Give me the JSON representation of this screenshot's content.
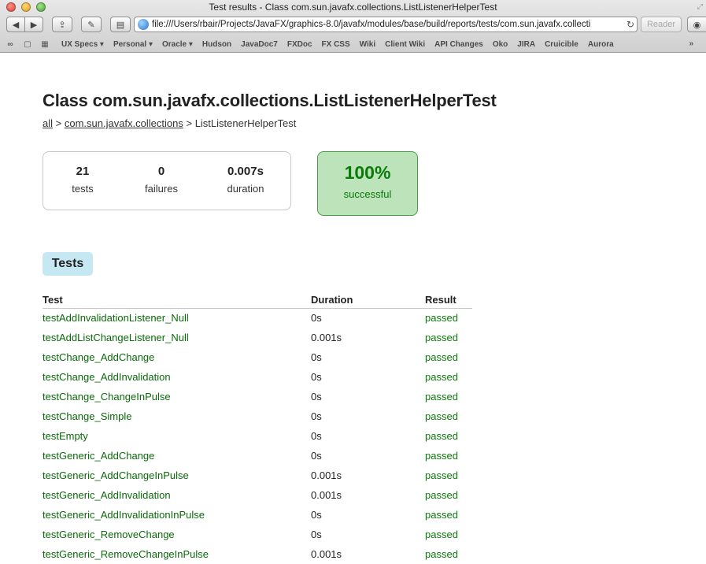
{
  "window": {
    "title": "Test results - Class com.sun.javafx.collections.ListListenerHelperTest",
    "url": "file:///Users/rbair/Projects/JavaFX/graphics-8.0/javafx/modules/base/build/reports/tests/com.sun.javafx.collecti",
    "reader_label": "Reader"
  },
  "bookmarks": [
    "UX Specs ▾",
    "Personal ▾",
    "Oracle ▾",
    "Hudson",
    "JavaDoc7",
    "FXDoc",
    "FX CSS",
    "Wiki",
    "Client Wiki",
    "API Changes",
    "Oko",
    "JIRA",
    "Cruicible",
    "Aurora"
  ],
  "page": {
    "title": "Class com.sun.javafx.collections.ListListenerHelperTest",
    "breadcrumb": {
      "all": "all",
      "sep1": " > ",
      "package": "com.sun.javafx.collections",
      "sep2": " > ",
      "current": "ListListenerHelperTest"
    },
    "summary": {
      "tests_value": "21",
      "tests_label": "tests",
      "failures_value": "0",
      "failures_label": "failures",
      "duration_value": "0.007s",
      "duration_label": "duration"
    },
    "success": {
      "percent": "100%",
      "label": "successful"
    },
    "tab_label": "Tests",
    "table": {
      "headers": [
        "Test",
        "Duration",
        "Result"
      ],
      "rows": [
        {
          "name": "testAddInvalidationListener_Null",
          "duration": "0s",
          "result": "passed"
        },
        {
          "name": "testAddListChangeListener_Null",
          "duration": "0.001s",
          "result": "passed"
        },
        {
          "name": "testChange_AddChange",
          "duration": "0s",
          "result": "passed"
        },
        {
          "name": "testChange_AddInvalidation",
          "duration": "0s",
          "result": "passed"
        },
        {
          "name": "testChange_ChangeInPulse",
          "duration": "0s",
          "result": "passed"
        },
        {
          "name": "testChange_Simple",
          "duration": "0s",
          "result": "passed"
        },
        {
          "name": "testEmpty",
          "duration": "0s",
          "result": "passed"
        },
        {
          "name": "testGeneric_AddChange",
          "duration": "0s",
          "result": "passed"
        },
        {
          "name": "testGeneric_AddChangeInPulse",
          "duration": "0.001s",
          "result": "passed"
        },
        {
          "name": "testGeneric_AddInvalidation",
          "duration": "0.001s",
          "result": "passed"
        },
        {
          "name": "testGeneric_AddInvalidationInPulse",
          "duration": "0s",
          "result": "passed"
        },
        {
          "name": "testGeneric_RemoveChange",
          "duration": "0s",
          "result": "passed"
        },
        {
          "name": "testGeneric_RemoveChangeInPulse",
          "duration": "0.001s",
          "result": "passed"
        }
      ]
    }
  },
  "colors": {
    "pass_green": "#0a7a0a",
    "success_bg": "#bde3bb",
    "tab_bg": "#c5e8f3"
  }
}
